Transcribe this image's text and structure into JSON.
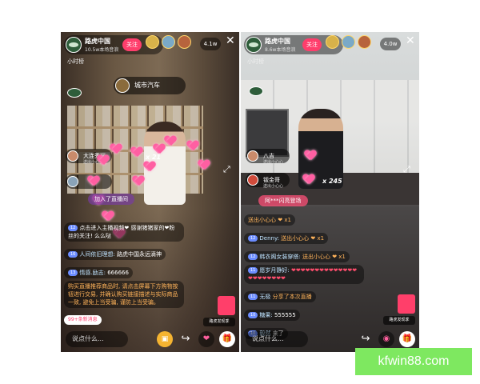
{
  "left_screen": {
    "host_name": "路虎中国",
    "viewers": "10.5w本场音浪",
    "follow_label": "关注",
    "audience_count": "4.1w",
    "rank_label": "小时榜",
    "car_badge": "城市汽车",
    "user_chip": {
      "name": "大连秀丽",
      "sub": "送出小心心"
    },
    "gift_count": "x 21",
    "entrance": "加入了直播间",
    "messages": [
      {
        "level": "12",
        "text": "点击进入主播视频❤ 感谢猪猪家的❤粉丝的关注! 么么哒"
      },
      {
        "level": "16",
        "user": "人间依旧理想:",
        "text": "路虎中国永远滴神"
      },
      {
        "level": "13",
        "user": "情感.励志:",
        "text": "666666"
      },
      {
        "level": "",
        "text": "购买直播推荐商品时, 请点击屏幕下方购物按钮进行交易, 并确认购买链接描述与实际商品一致, 避免上当受骗, 谨防上当受骗。",
        "orange": true
      }
    ],
    "new_msgs": "99+条新消息",
    "shop_label": "路虎发现季",
    "comment_placeholder": "说点什么..."
  },
  "right_screen": {
    "host_name": "路虎中国",
    "viewers": "8.6w本场音浪",
    "follow_label": "关注",
    "audience_count": "4.0w",
    "rank_label": "小时榜",
    "user_chip_1": {
      "name": "八吉",
      "sub": "送出小心心"
    },
    "user_chip_2": {
      "name": "钣金哥",
      "sub": "送出小心心"
    },
    "gift_count": "x 245",
    "entrance": "阿***闪亮登场",
    "messages": [
      {
        "level": "",
        "user": "",
        "text": "送出小心心 ❤ x1"
      },
      {
        "level": "12",
        "user": "Denny:",
        "text": "送出小心心 ❤ x1"
      },
      {
        "level": "12",
        "user": "韩衣阁女装穿搭:",
        "text": "送出小心心 ❤ x1"
      },
      {
        "level": "11",
        "user": "愿岁月静好:",
        "text": "❤❤❤❤❤❤❤❤❤❤❤❤❤❤❤❤❤❤❤❤❤❤"
      },
      {
        "level": "11",
        "user": "无极",
        "text": "分享了本次直播"
      },
      {
        "level": "10",
        "user": "糖果:",
        "text": "555555"
      },
      {
        "level": "10",
        "user": "毅然",
        "text": "来了"
      }
    ],
    "shop_label": "路虎发现季",
    "comment_placeholder": "说点什么..."
  },
  "watermark": "kfwin88.com"
}
